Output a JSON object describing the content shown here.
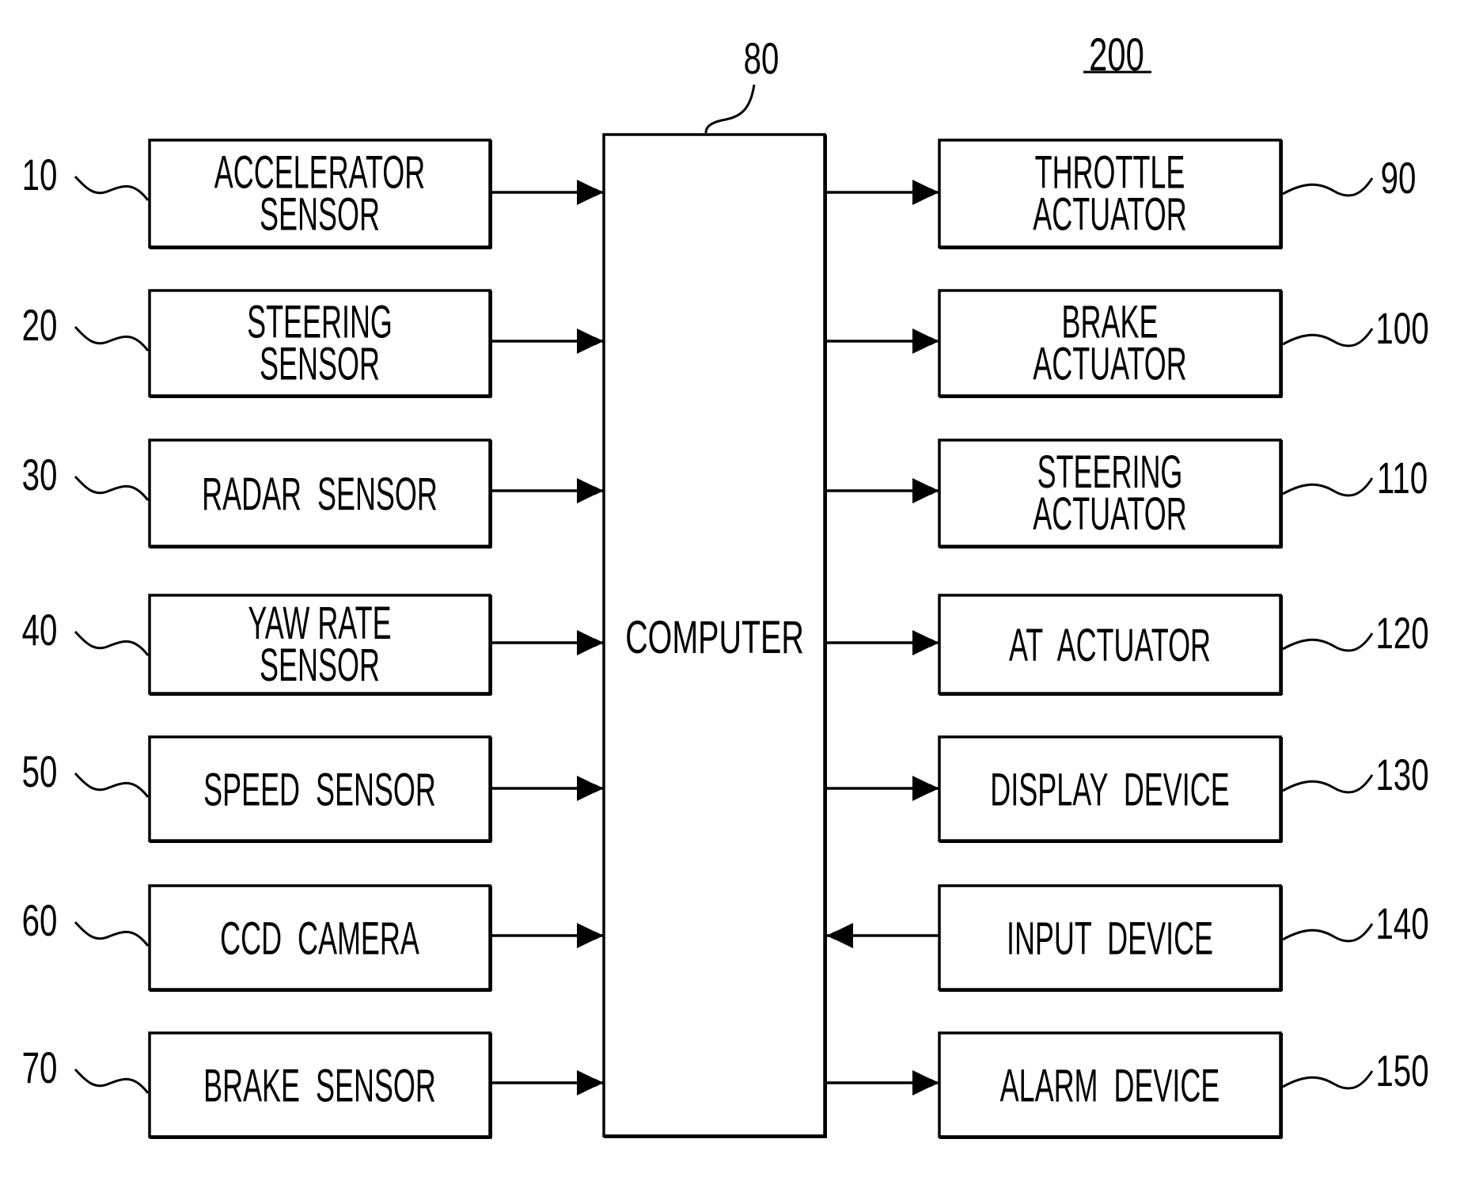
{
  "diagram": {
    "system_ref": "200",
    "computer": {
      "ref": "80",
      "label": "COMPUTER"
    },
    "inputs": [
      {
        "ref": "10",
        "lines": [
          "ACCELERATOR",
          "SENSOR"
        ],
        "direction": "to-computer"
      },
      {
        "ref": "20",
        "lines": [
          "STEERING",
          "SENSOR"
        ],
        "direction": "to-computer"
      },
      {
        "ref": "30",
        "lines": [
          "RADAR  SENSOR"
        ],
        "direction": "to-computer"
      },
      {
        "ref": "40",
        "lines": [
          "YAW RATE",
          "SENSOR"
        ],
        "direction": "to-computer"
      },
      {
        "ref": "50",
        "lines": [
          "SPEED  SENSOR"
        ],
        "direction": "to-computer"
      },
      {
        "ref": "60",
        "lines": [
          "CCD  CAMERA"
        ],
        "direction": "to-computer"
      },
      {
        "ref": "70",
        "lines": [
          "BRAKE  SENSOR"
        ],
        "direction": "to-computer"
      }
    ],
    "outputs": [
      {
        "ref": "90",
        "lines": [
          "THROTTLE",
          "ACTUATOR"
        ],
        "direction": "from-computer"
      },
      {
        "ref": "100",
        "lines": [
          "BRAKE",
          "ACTUATOR"
        ],
        "direction": "from-computer"
      },
      {
        "ref": "110",
        "lines": [
          "STEERING",
          "ACTUATOR"
        ],
        "direction": "from-computer"
      },
      {
        "ref": "120",
        "lines": [
          "AT  ACTUATOR"
        ],
        "direction": "from-computer"
      },
      {
        "ref": "130",
        "lines": [
          "DISPLAY  DEVICE"
        ],
        "direction": "from-computer"
      },
      {
        "ref": "140",
        "lines": [
          "INPUT  DEVICE"
        ],
        "direction": "to-computer"
      },
      {
        "ref": "150",
        "lines": [
          "ALARM  DEVICE"
        ],
        "direction": "from-computer"
      }
    ]
  }
}
